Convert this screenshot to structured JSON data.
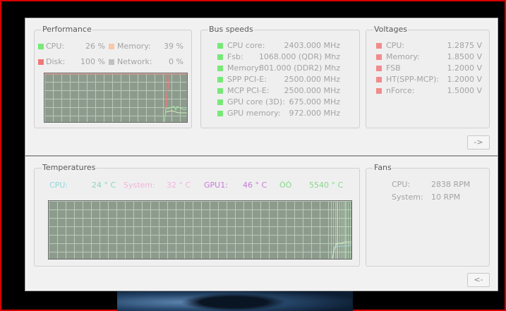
{
  "top": {
    "performance": {
      "title": "Performance",
      "cpu": {
        "label": "CPU:",
        "value": "26 %",
        "color": "#78e878"
      },
      "memory": {
        "label": "Memory:",
        "value": "39 %",
        "color": "#f8c8a8"
      },
      "disk": {
        "label": "Disk:",
        "value": "100 %",
        "color": "#f07878"
      },
      "network": {
        "label": "Network:",
        "value": "0 %",
        "color": "#c0c0c0"
      }
    },
    "bus": {
      "title": "Bus speeds",
      "items": [
        {
          "label": "CPU core:",
          "value": "2403.000 MHz"
        },
        {
          "label": "Fsb:",
          "value": "1068.000 (QDR) Mhz"
        },
        {
          "label": "Memory:",
          "value": "801.000 (DDR2) Mhz"
        },
        {
          "label": "SPP PCI-E:",
          "value": "2500.000 MHz"
        },
        {
          "label": "MCP PCI-E:",
          "value": "2500.000 MHz"
        },
        {
          "label": "GPU core (3D):",
          "value": "675.000 MHz"
        },
        {
          "label": "GPU memory:",
          "value": "972.000 MHz"
        }
      ],
      "color": "#78e878"
    },
    "voltages": {
      "title": "Voltages",
      "items": [
        {
          "label": "CPU:",
          "value": "1.2875 V"
        },
        {
          "label": "Memory:",
          "value": "1.8500 V"
        },
        {
          "label": "FSB",
          "value": "1.2000 V"
        },
        {
          "label": "HT(SPP-MCP):",
          "value": "1.2000 V"
        },
        {
          "label": "nForce:",
          "value": "1.5000 V"
        }
      ],
      "color": "#f08c8c"
    },
    "forward_button": "->"
  },
  "bottom": {
    "temperatures": {
      "title": "Temperatures",
      "cpu": {
        "label": "CPU:",
        "value": "24 ° C",
        "color": "#8fd8d8",
        "value_color": "#8ad8b8"
      },
      "system": {
        "label": "System:",
        "value": "32 ° C",
        "color": "#f4b4d8"
      },
      "gpu": {
        "label": "GPU1:",
        "value": "46 ° C",
        "color": "#c878d8"
      },
      "extra": {
        "label": "ÒÒ",
        "value": "5540 ° C",
        "color": "#88d888"
      }
    },
    "fans": {
      "title": "Fans",
      "items": [
        {
          "label": "CPU:",
          "value": "2838 RPM"
        },
        {
          "label": "System:",
          "value": "10 RPM"
        }
      ]
    },
    "back_button": "<-"
  }
}
